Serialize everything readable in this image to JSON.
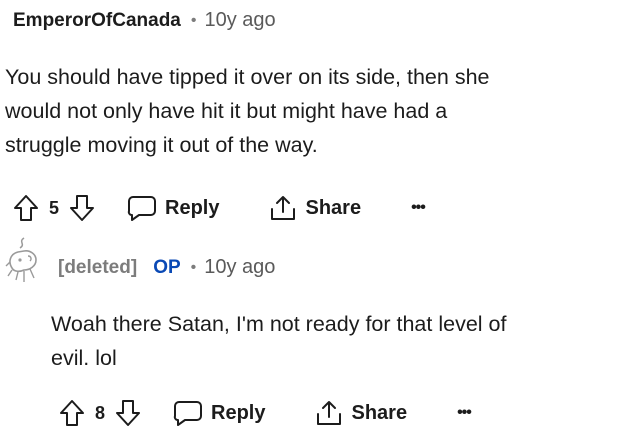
{
  "comment1": {
    "author": "EmperorOfCanada",
    "time": "10y ago",
    "lines": [
      "You should have tipped it over on its side, then she",
      "would not only have hit it but might have had a",
      "struggle moving it out of the way."
    ],
    "votes": "5",
    "reply_label": "Reply",
    "share_label": "Share",
    "more_label": "•••"
  },
  "comment2": {
    "author": "[deleted]",
    "badge": "OP",
    "time": "10y ago",
    "lines": [
      "Woah there Satan, I'm not ready for that level of",
      "evil. lol"
    ],
    "votes": "8",
    "reply_label": "Reply",
    "share_label": "Share",
    "more_label": "•••"
  },
  "separator": "•",
  "icons": {
    "upvote": "arrow-up-outline",
    "downvote": "arrow-down-outline",
    "reply": "speech-bubble",
    "share": "share-arrow",
    "avatar": "deleted-user-avatar"
  }
}
